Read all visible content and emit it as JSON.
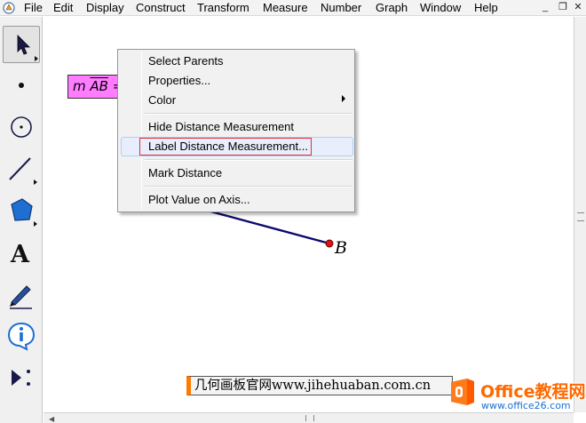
{
  "menubar": {
    "items": [
      {
        "label": "File"
      },
      {
        "label": "Edit"
      },
      {
        "label": "Display"
      },
      {
        "label": "Construct"
      },
      {
        "label": "Transform"
      },
      {
        "label": "Measure"
      },
      {
        "label": "Number"
      },
      {
        "label": "Graph"
      },
      {
        "label": "Window"
      },
      {
        "label": "Help"
      }
    ],
    "window_controls": {
      "minimize": "_",
      "restore": "❐",
      "close": "✕"
    }
  },
  "toolbox": {
    "tools": [
      {
        "name": "arrow-tool",
        "icon": "arrow-icon",
        "selected": true
      },
      {
        "name": "point-tool",
        "icon": "point-icon"
      },
      {
        "name": "compass-tool",
        "icon": "compass-icon"
      },
      {
        "name": "straightedge-tool",
        "icon": "segment-icon"
      },
      {
        "name": "polygon-tool",
        "icon": "polygon-icon"
      },
      {
        "name": "text-tool",
        "icon": "text-a-icon",
        "glyph": "A"
      },
      {
        "name": "marker-tool",
        "icon": "marker-icon"
      },
      {
        "name": "information-tool",
        "icon": "info-icon"
      },
      {
        "name": "custom-tool",
        "icon": "custom-tools-icon"
      }
    ]
  },
  "canvas": {
    "measurement": {
      "prefix": "m ",
      "segment": "AB",
      "suffix": " ="
    },
    "point_label": "B",
    "segment_color": "#0b0b6e",
    "point_color": "#e01010",
    "watermark": "几何画板官网www.jihehuaban.com.cn"
  },
  "context_menu": {
    "items": [
      {
        "label": "Select Parents"
      },
      {
        "label": "Properties..."
      },
      {
        "label": "Color",
        "submenu": true
      },
      {
        "label": "Hide Distance Measurement"
      },
      {
        "label": "Label Distance Measurement...",
        "highlighted": true
      },
      {
        "label": "Mark Distance"
      },
      {
        "label": "Plot Value on Axis..."
      }
    ]
  },
  "logo": {
    "title": "Office教程网",
    "url": "www.office26.com"
  }
}
